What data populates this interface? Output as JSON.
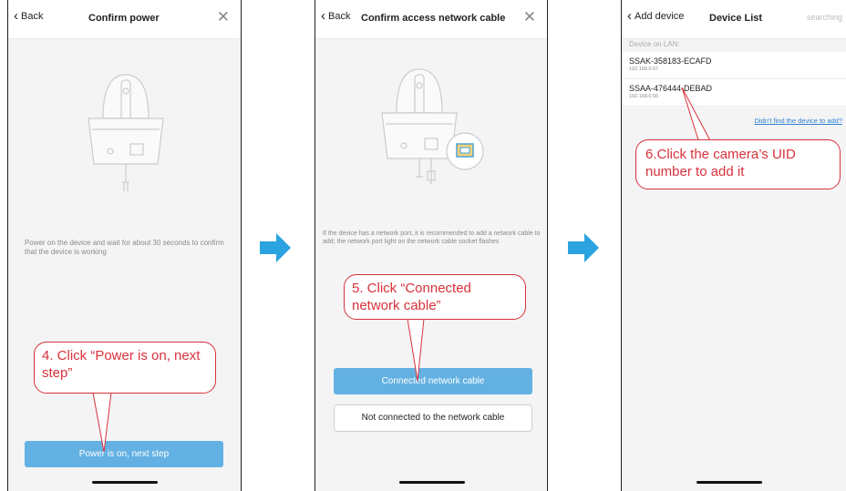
{
  "screen1": {
    "back_label": "Back",
    "title": "Confirm power",
    "close_glyph": "✕",
    "description": "Power on the device and wait for about 30 seconds to confirm that the device is working",
    "primary_button": "Power is on, next step",
    "callout": "4. Click “Power is on, next step”"
  },
  "screen2": {
    "back_label": "Back",
    "title": "Confirm access network cable",
    "close_glyph": "✕",
    "description": "If the device has a network port, it is recommended to add a network cable to add; the network port light on the network cable socket flashes",
    "primary_button": "Connected network cable",
    "secondary_button": "Not connected to the network cable",
    "callout": "5. Click “Connected network cable”"
  },
  "screen3": {
    "back_label": "Add device",
    "title": "Device List",
    "status": "searching",
    "section_label": "Device on LAN:",
    "devices": [
      {
        "uid": "SSAK-358183-ECAFD",
        "ip": "192.168.0.57"
      },
      {
        "uid": "SSAA-476444-DEBAD",
        "ip": "192.168.0.56"
      }
    ],
    "help_link": "Didn't find the device to add?",
    "callout": "6.Click the camera’s UID number to add it"
  },
  "colors": {
    "accent_blue": "#63b1e2",
    "arrow_blue": "#2aa3e0",
    "callout_red": "#d8313b"
  }
}
